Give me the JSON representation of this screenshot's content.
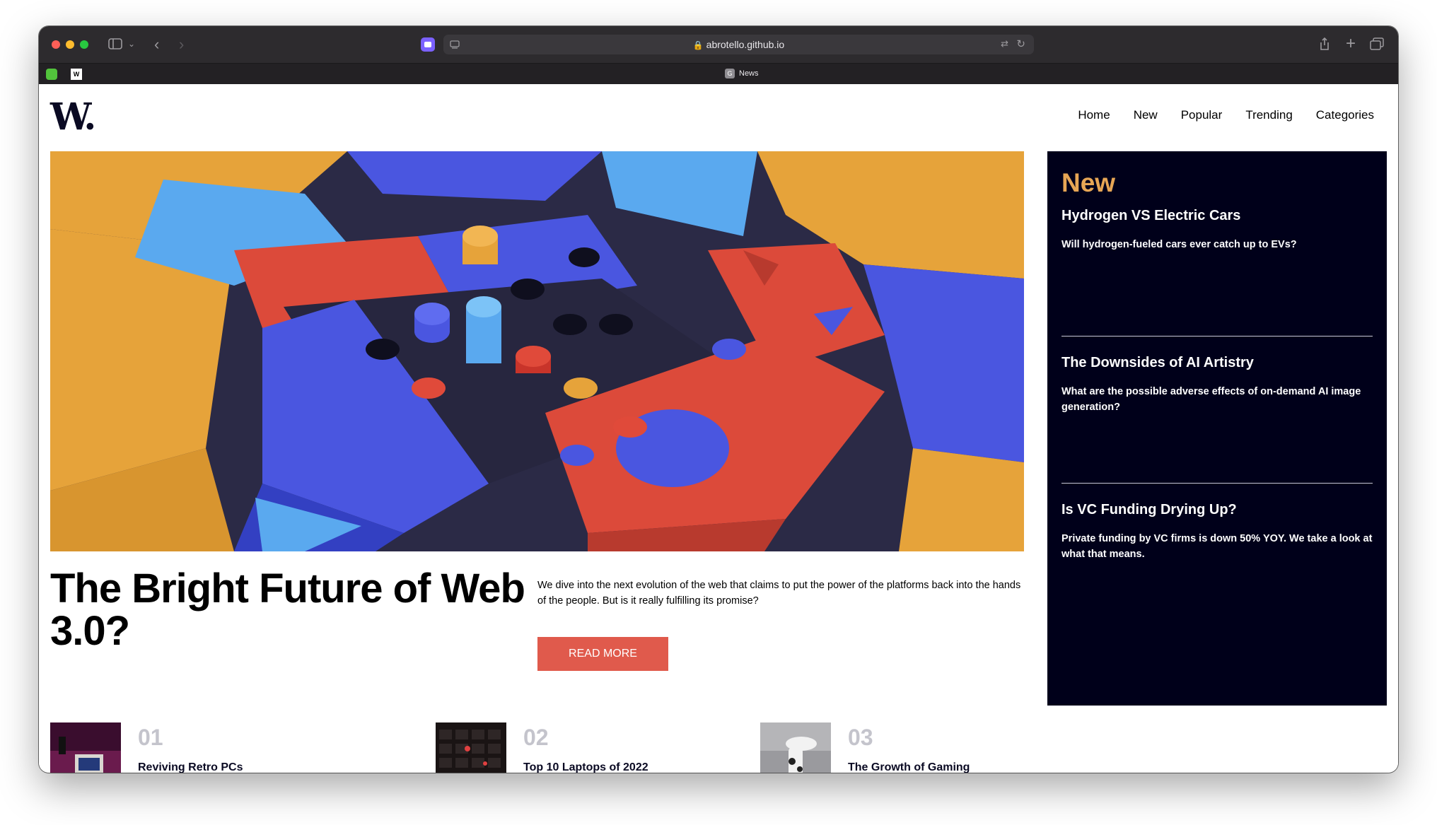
{
  "browser": {
    "url": "abrotello.github.io",
    "active_tab_label": "News",
    "active_tab_favicon_letter": "G",
    "pinned_tab_letter": "W"
  },
  "site": {
    "logo": "W.",
    "nav": [
      "Home",
      "New",
      "Popular",
      "Trending",
      "Categories"
    ]
  },
  "hero": {
    "title": "The Bright Future of Web 3.0?",
    "description": "We dive into the next evolution of the web that claims to put the power of the platforms back into the hands of the people. But is it really fulfilling its promise?",
    "button": "READ MORE"
  },
  "sidebar": {
    "heading": "New",
    "items": [
      {
        "title": "Hydrogen VS Electric Cars",
        "desc": "Will hydrogen-fueled cars ever catch up to EVs?"
      },
      {
        "title": "The Downsides of AI Artistry",
        "desc": "What are the possible adverse effects of on-demand AI image generation?"
      },
      {
        "title": "Is VC Funding Drying Up?",
        "desc": "Private funding by VC firms is down 50% YOY. We take a look at what that means."
      }
    ]
  },
  "bottom": [
    {
      "num": "01",
      "title": "Reviving Retro PCs"
    },
    {
      "num": "02",
      "title": "Top 10 Laptops of 2022"
    },
    {
      "num": "03",
      "title": "The Growth of Gaming"
    }
  ],
  "colors": {
    "accent_button": "#e05a4c",
    "sidebar_bg": "#00001a",
    "sidebar_heading": "#e7a655",
    "number_gray": "#c4c4cc"
  }
}
